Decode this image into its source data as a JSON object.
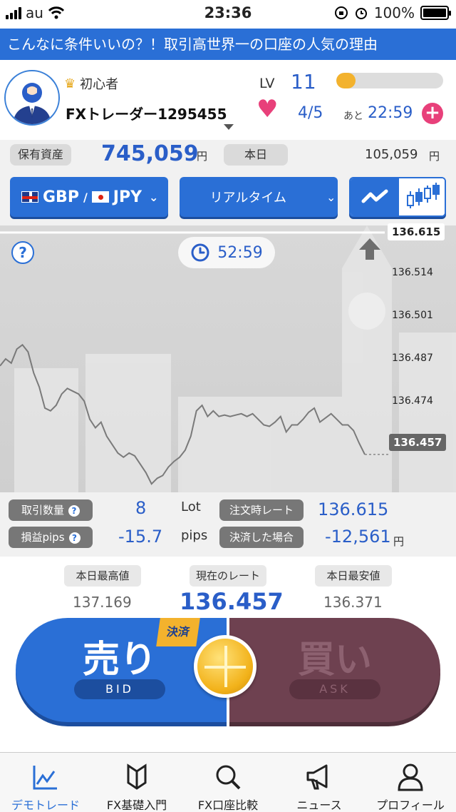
{
  "status_bar": {
    "carrier": "au",
    "time": "23:36",
    "battery": "100%"
  },
  "banner": {
    "text": "こんなに条件いいの？！取引高世界一の口座の人気の理由"
  },
  "profile": {
    "rank": "初心者",
    "username": "FXトレーダー1295455",
    "lv_label": "LV",
    "lv_value": "11",
    "xp_progress": 0.18,
    "hearts": "4/5",
    "ato_label": "あと",
    "refill_timer": "22:59",
    "plus": "+"
  },
  "assets": {
    "holdings_label": "保有資産",
    "holdings_value": "745,059",
    "holdings_unit": "円",
    "today_label": "本日",
    "today_value": "105,059",
    "today_unit": "円"
  },
  "selectors": {
    "base_currency": "GBP",
    "slash": "/",
    "quote_currency": "JPY",
    "mode": "リアルタイム"
  },
  "chart": {
    "help": "?",
    "countdown": "52:59",
    "order_rate_tag": "136.615",
    "current_rate_tag": "136.457",
    "ticks": [
      "136.514",
      "136.501",
      "136.487",
      "136.474"
    ]
  },
  "chart_data": {
    "type": "line",
    "ylim": [
      136.43,
      136.62
    ],
    "series": [
      {
        "values": [
          136.52,
          136.525,
          136.522,
          136.532,
          136.535,
          136.53,
          136.515,
          136.505,
          136.49,
          136.488,
          136.492,
          136.5,
          136.504,
          136.502,
          136.5,
          136.495,
          136.482,
          136.476,
          136.48,
          136.47,
          136.464,
          136.458,
          136.455,
          136.458,
          136.456,
          136.45,
          136.444,
          136.436,
          136.44,
          136.442,
          136.448,
          136.452,
          136.455,
          136.46,
          136.47,
          136.488,
          136.492,
          136.484,
          136.488,
          136.484,
          136.485,
          136.484,
          136.485,
          136.486,
          136.484,
          136.486,
          136.482,
          136.478,
          136.477,
          136.48,
          136.484,
          136.473,
          136.478,
          136.478,
          136.482,
          136.487,
          136.49,
          136.48,
          136.483,
          136.486,
          136.482,
          136.478,
          136.478,
          136.474,
          136.465,
          136.457
        ]
      }
    ]
  },
  "trade_info": {
    "quantity_label": "取引数量",
    "quantity_value": "8",
    "quantity_unit": "Lot",
    "order_rate_label": "注文時レート",
    "order_rate_value": "136.615",
    "pips_label": "損益pips",
    "pips_value": "-15.7",
    "pips_unit": "pips",
    "settle_label": "決済した場合",
    "settle_value": "-12,561",
    "settle_unit": "円"
  },
  "rates": {
    "high_label": "本日最高値",
    "high_value": "137.169",
    "current_label": "現在のレート",
    "current_value": "136.457",
    "low_label": "本日最安値",
    "low_value": "136.371"
  },
  "trade": {
    "sell_label": "売り",
    "sell_sub": "BID",
    "buy_label": "買い",
    "buy_sub": "ASK",
    "settle_badge": "決済"
  },
  "nav": [
    {
      "label": "デモトレード",
      "icon": "chart-icon"
    },
    {
      "label": "FX基礎入門",
      "icon": "beginner-mark-icon"
    },
    {
      "label": "FX口座比較",
      "icon": "search-icon"
    },
    {
      "label": "ニュース",
      "icon": "megaphone-icon"
    },
    {
      "label": "プロフィール",
      "icon": "person-icon"
    }
  ],
  "colors": {
    "accent": "#2a6fd6",
    "sell": "#2a6fd6",
    "buy": "#6e4150",
    "heart": "#e8407a",
    "gold": "#f3b22d"
  }
}
